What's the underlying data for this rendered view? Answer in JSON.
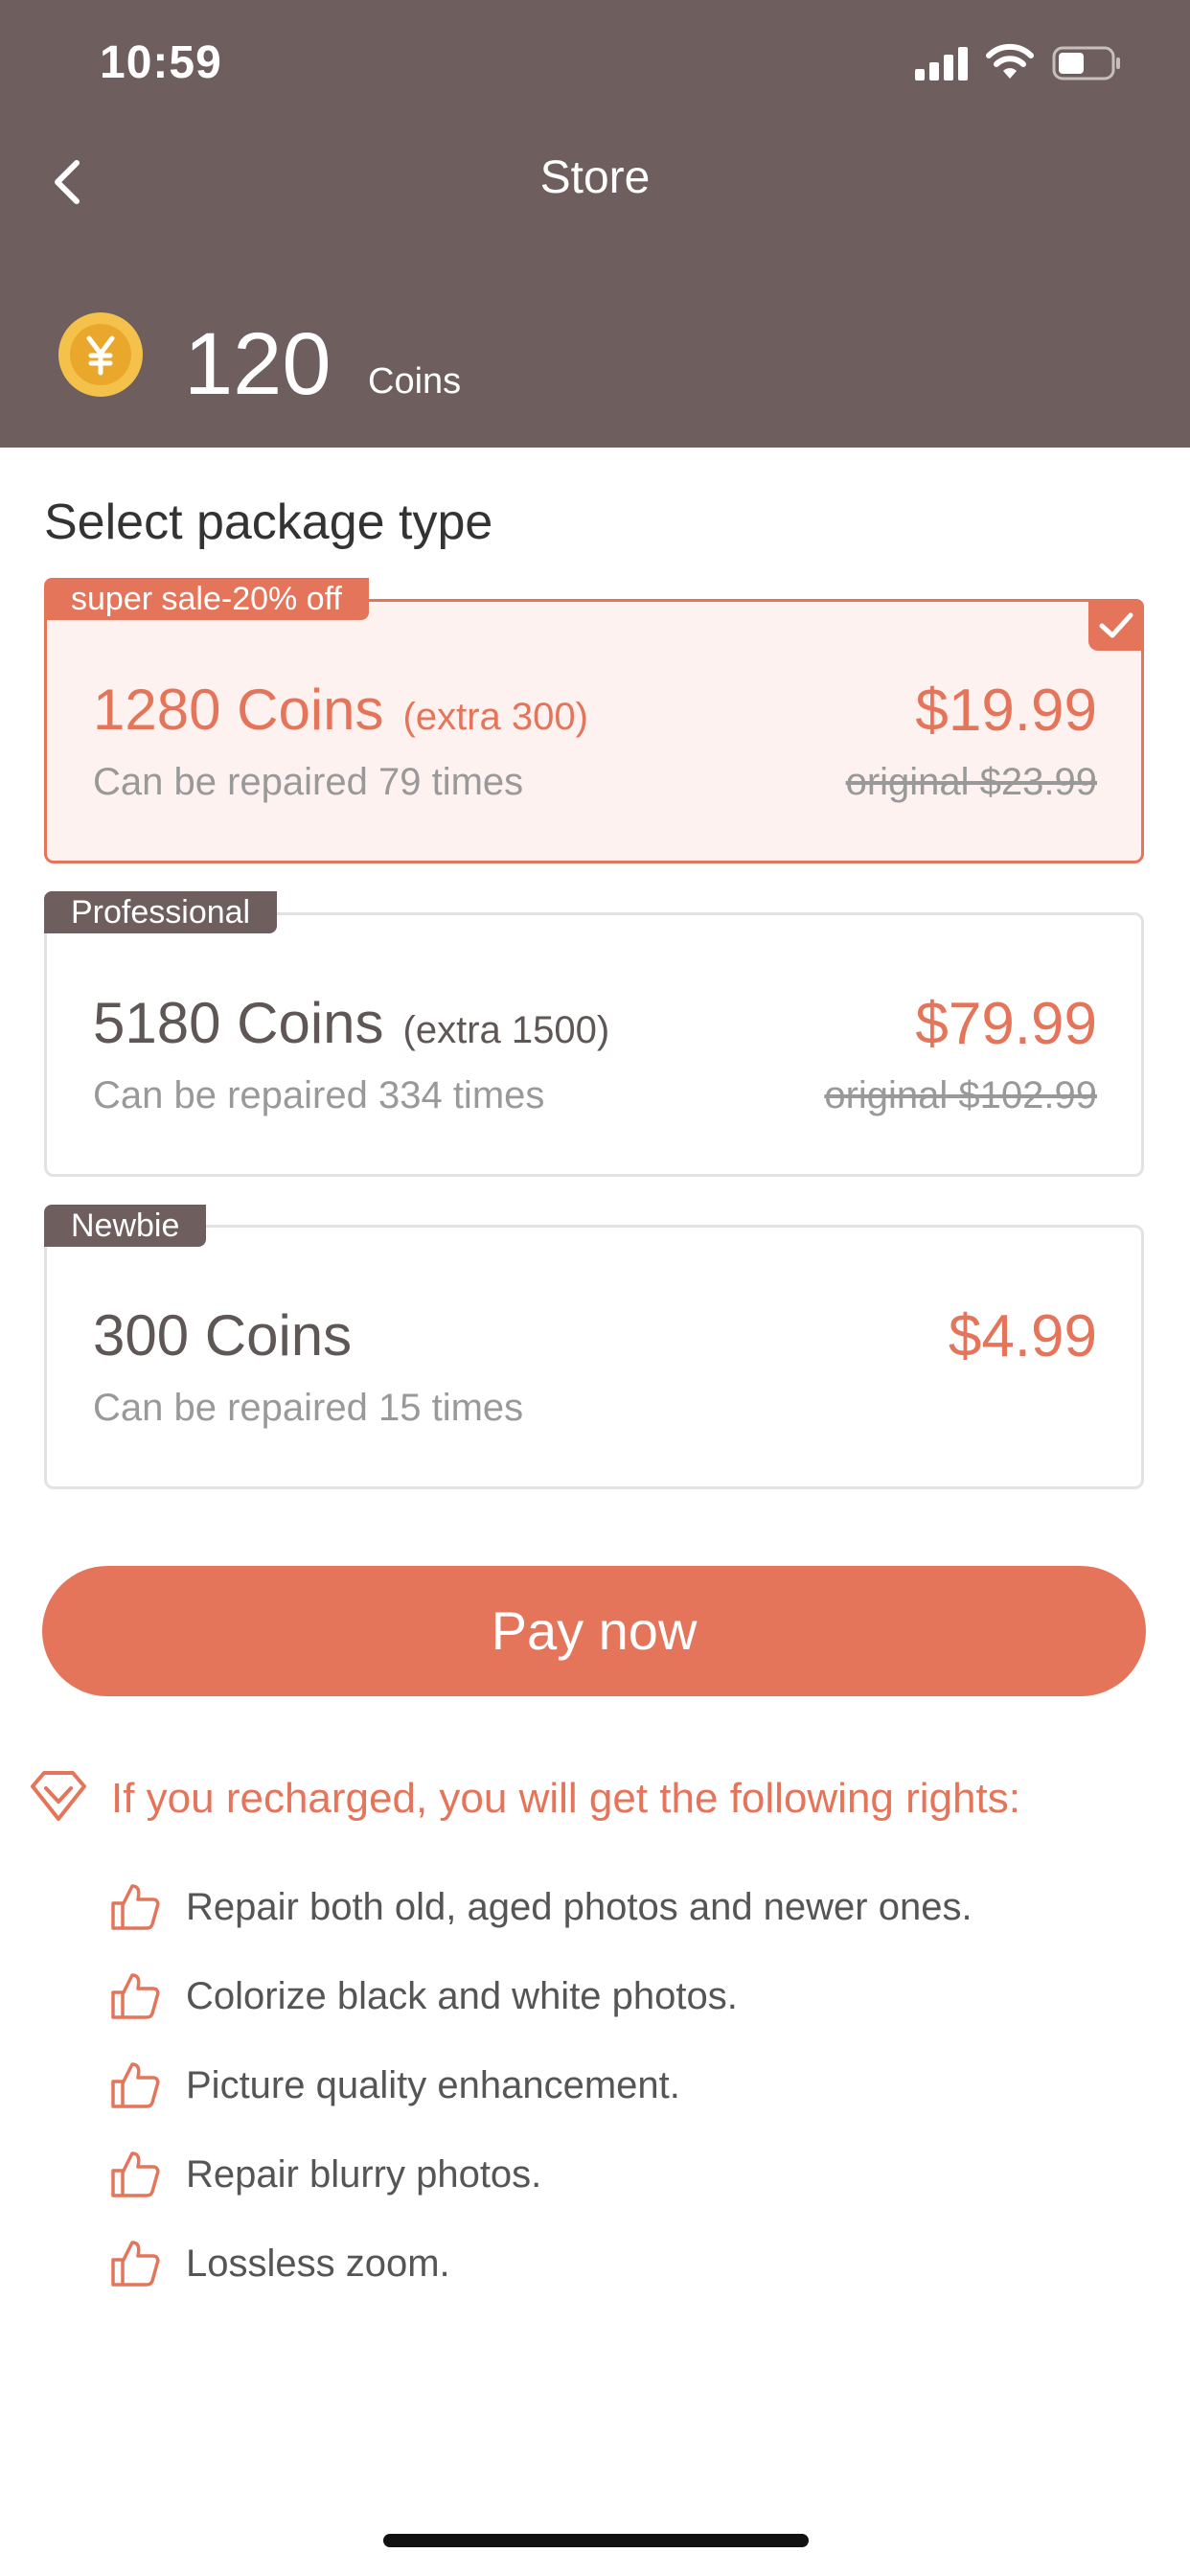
{
  "status_bar": {
    "time": "10:59"
  },
  "nav": {
    "title": "Store"
  },
  "balance": {
    "value": "120",
    "unit": "Coins"
  },
  "section_title": "Select package type",
  "packages": [
    {
      "tag": "super sale-20% off",
      "coins": "1280 Coins",
      "extra": "(extra 300)",
      "desc": "Can be repaired 79 times",
      "price": "$19.99",
      "original": "original $23.99",
      "selected": true
    },
    {
      "tag": "Professional",
      "coins": "5180 Coins",
      "extra": "(extra 1500)",
      "desc": "Can be repaired 334 times",
      "price": "$79.99",
      "original": "original $102.99",
      "selected": false
    },
    {
      "tag": "Newbie",
      "coins": "300 Coins",
      "desc": "Can be repaired 15 times",
      "price": "$4.99",
      "selected": false
    }
  ],
  "pay_button": "Pay now",
  "rights": {
    "title": "If you recharged, you will get the following rights:",
    "items": [
      "Repair both old, aged photos and newer ones.",
      "Colorize black and white photos.",
      "Picture quality enhancement.",
      "Repair blurry photos.",
      "Lossless zoom."
    ]
  },
  "colors": {
    "header_bg": "#6e5f5e",
    "accent": "#e4755b",
    "selected_bg": "#fdf2ef"
  },
  "icons": {
    "back": "chevron-left-icon",
    "coin": "yen-coin-icon",
    "check": "checkmark-icon",
    "rights": "diamond-icon",
    "right_item": "thumbs-up-icon"
  }
}
